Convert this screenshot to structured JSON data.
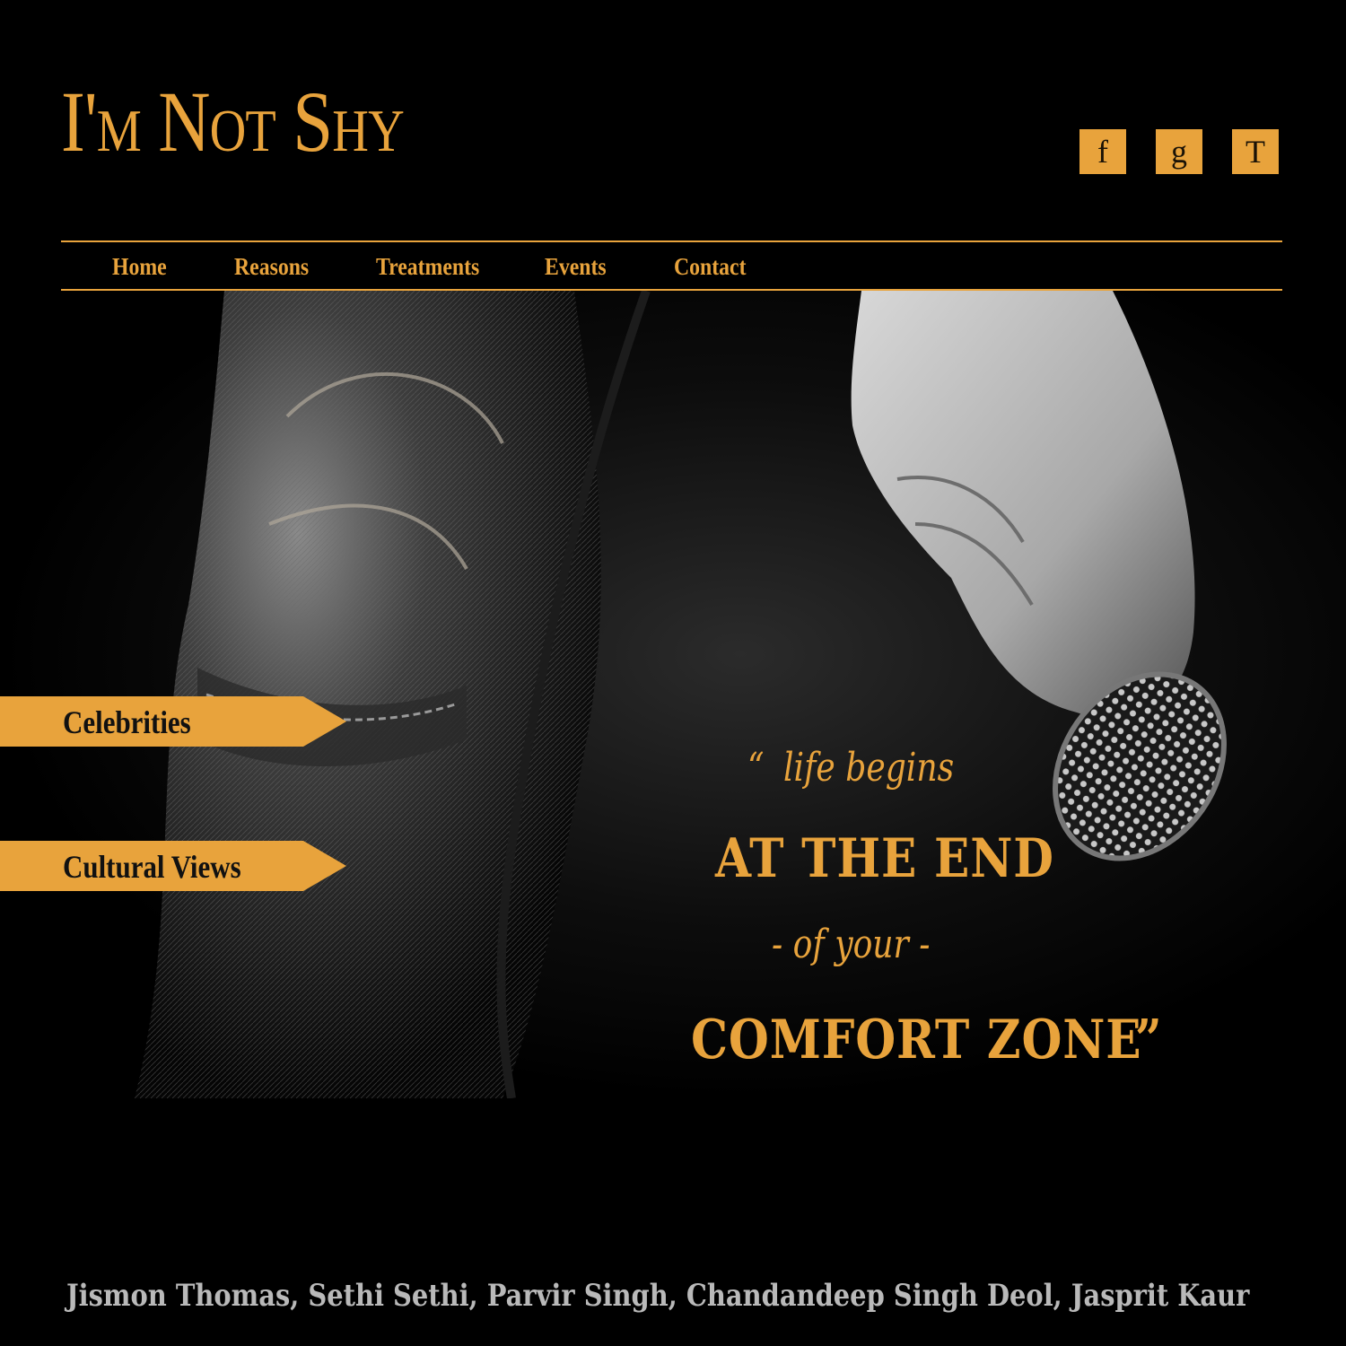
{
  "site": {
    "title": "I'm Not Shy"
  },
  "social": [
    {
      "label": "f",
      "icon": "facebook-icon"
    },
    {
      "label": "g",
      "icon": "google-plus-icon"
    },
    {
      "label": "T",
      "icon": "twitter-icon"
    }
  ],
  "nav": {
    "items": [
      "Home",
      "Reasons",
      "Treatments",
      "Events",
      "Contact"
    ]
  },
  "side_links": [
    "Celebrities",
    "Cultural Views"
  ],
  "quote": {
    "open_mark": "“",
    "line1": "life begins",
    "line2": "AT THE END",
    "line3": "- of your -",
    "line4": "COMFORT ZONE",
    "close_mark": "”"
  },
  "footer": {
    "credits": "Jismon Thomas, Sethi Sethi, Parvir Singh, Chandandeep Singh Deol, Jasprit Kaur"
  },
  "colors": {
    "accent": "#e8a33c",
    "background": "#000000",
    "credits": "#b9b9b9"
  }
}
